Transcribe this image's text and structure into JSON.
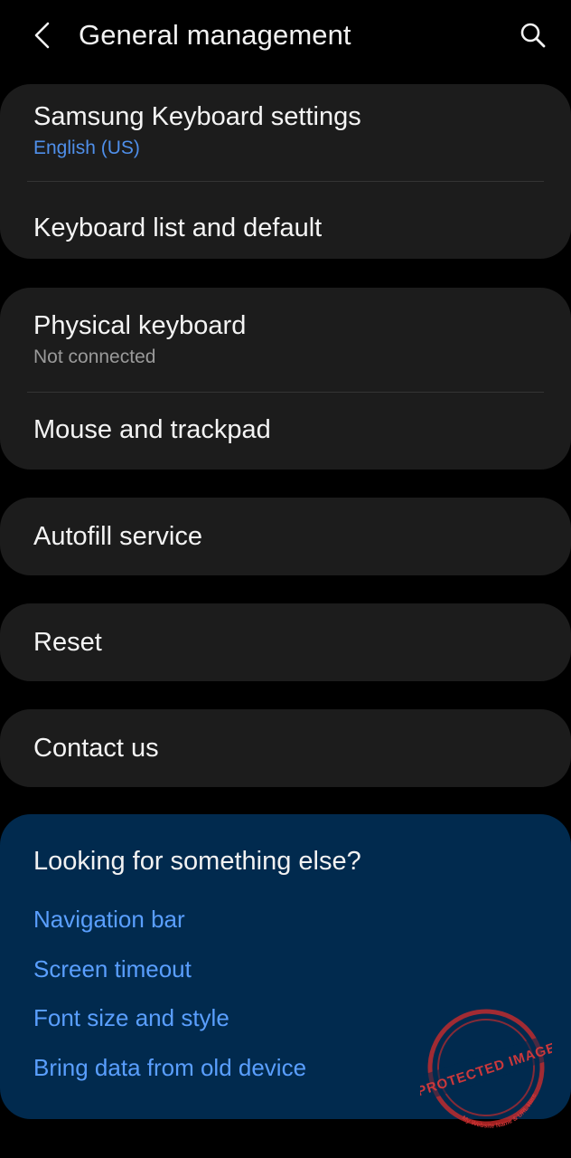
{
  "header": {
    "title": "General management"
  },
  "groups": [
    {
      "items": [
        {
          "title": "Samsung Keyboard settings",
          "subtitle": "English (US)"
        },
        {
          "title": "Keyboard list and default"
        }
      ]
    },
    {
      "items": [
        {
          "title": "Physical keyboard",
          "subtitle": "Not connected"
        },
        {
          "title": "Mouse and trackpad"
        }
      ]
    },
    {
      "items": [
        {
          "title": "Autofill service"
        }
      ]
    },
    {
      "items": [
        {
          "title": "Reset"
        }
      ]
    },
    {
      "items": [
        {
          "title": "Contact us"
        }
      ]
    }
  ],
  "suggestions": {
    "title": "Looking for something else?",
    "links": [
      "Navigation bar",
      "Screen timeout",
      "Font size and style",
      "Bring data from old device"
    ]
  },
  "watermark": {
    "text": "PROTECTED IMAGE",
    "subtext": "My Website Name & URL Here"
  },
  "colors": {
    "background": "#000000",
    "card": "#1c1c1c",
    "accent_blue": "#5a9fff",
    "suggestion_bg": "#012a4e"
  }
}
